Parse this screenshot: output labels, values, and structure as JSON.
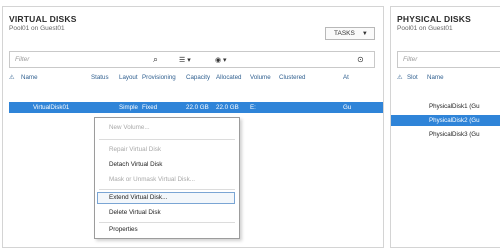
{
  "virtual_disks": {
    "title": "VIRTUAL DISKS",
    "subtitle": "Pool01 on Guest01",
    "tasks_label": "TASKS",
    "filter_placeholder": "Filter",
    "columns": [
      "Name",
      "Status",
      "Layout",
      "Provisioning",
      "Capacity",
      "Allocated",
      "Volume",
      "Clustered",
      "At"
    ],
    "selected_row": {
      "name": "VirtualDisk01",
      "status": "",
      "layout": "Simple",
      "provisioning": "Fixed",
      "capacity": "22.0 GB",
      "allocated": "22.0 GB",
      "volume": "E:",
      "clustered": "",
      "attached": "Gu"
    }
  },
  "context_menu": {
    "items": [
      {
        "label": "New Volume...",
        "enabled": false
      },
      {
        "label": "Repair Virtual Disk",
        "enabled": false
      },
      {
        "label": "Detach Virtual Disk",
        "enabled": true
      },
      {
        "label": "Mask or Unmask Virtual Disk...",
        "enabled": false
      },
      {
        "label": "Extend Virtual Disk...",
        "enabled": true,
        "hovered": true
      },
      {
        "label": "Delete Virtual Disk",
        "enabled": true
      },
      {
        "label": "Properties",
        "enabled": true
      }
    ]
  },
  "physical_disks": {
    "title": "PHYSICAL DISKS",
    "subtitle": "Pool01 on Guest01",
    "filter_placeholder": "Filter",
    "columns": [
      "Slot",
      "Name"
    ],
    "rows": [
      {
        "name": "PhysicalDisk1 (Gu",
        "selected": false
      },
      {
        "name": "PhysicalDisk2 (Gu",
        "selected": true
      },
      {
        "name": "PhysicalDisk3 (Gu",
        "selected": false
      }
    ]
  },
  "colors": {
    "selection": "#2f84d8",
    "header_text": "#2f5f8f"
  }
}
